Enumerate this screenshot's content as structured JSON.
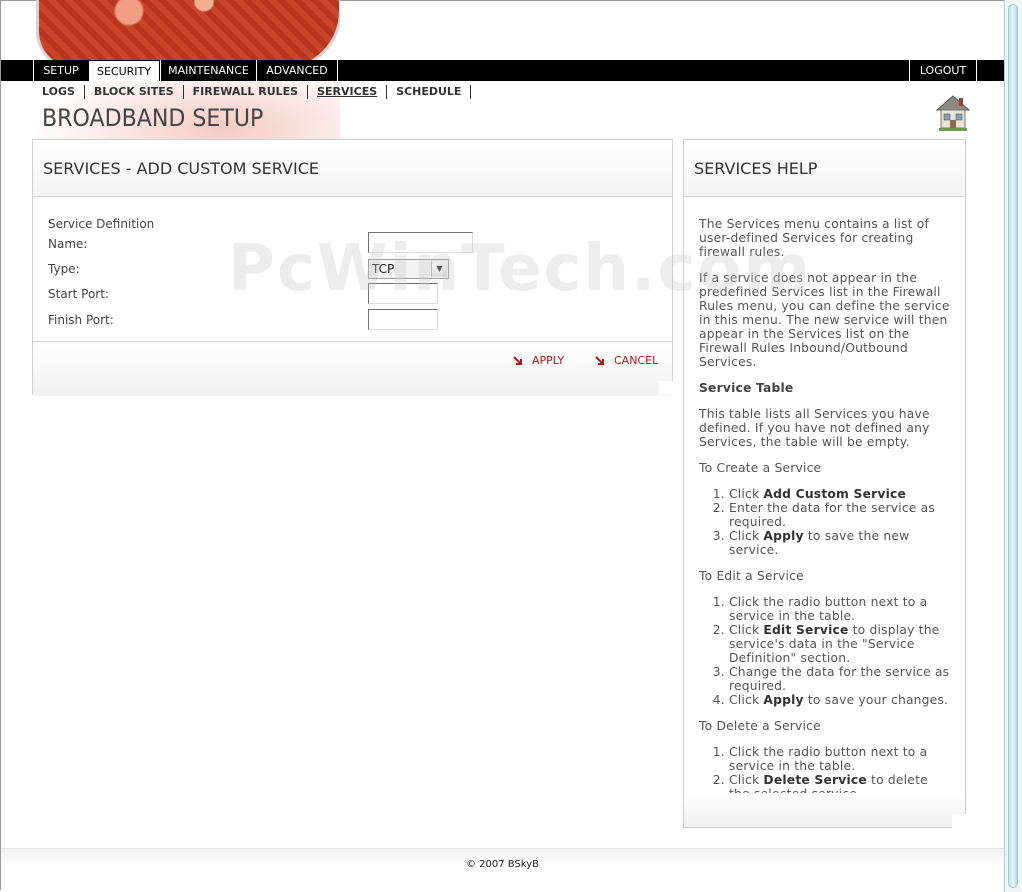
{
  "nav": {
    "tabs": [
      {
        "label": "SETUP"
      },
      {
        "label": "SECURITY"
      },
      {
        "label": "MAINTENANCE"
      },
      {
        "label": "ADVANCED"
      }
    ],
    "logout": "LOGOUT",
    "active_tab": "SECURITY"
  },
  "subnav": {
    "items": [
      {
        "label": "LOGS"
      },
      {
        "label": "BLOCK SITES"
      },
      {
        "label": "FIREWALL RULES"
      },
      {
        "label": "SERVICES"
      },
      {
        "label": "SCHEDULE"
      }
    ],
    "current": "SERVICES"
  },
  "page_title": "BROADBAND SETUP",
  "main_panel": {
    "title": "SERVICES - ADD CUSTOM SERVICE",
    "section_label": "Service Definition",
    "name_label": "Name:",
    "name_value": "",
    "type_label": "Type:",
    "type_value": "TCP",
    "start_port_label": "Start Port:",
    "start_port_value": "",
    "finish_port_label": "Finish Port:",
    "finish_port_value": "",
    "apply_label": "APPLY",
    "cancel_label": "CANCEL"
  },
  "help": {
    "title": "SERVICES HELP",
    "intro": "The Services menu contains a list of user-defined Services for creating firewall rules.",
    "para2": "If a service does not appear in the predefined Services list in the Firewall Rules menu, you can define the service in this menu. The new service will then appear in the Services list on the Firewall Rules Inbound/Outbound Services.",
    "table_heading": "Service Table",
    "table_text": "This table lists all Services you have defined. If you have not defined any Services, the table will be empty.",
    "create_heading": "To Create a Service",
    "create_1_pre": "Click ",
    "create_1_bold": "Add Custom Service",
    "create_2": "Enter the data for the service as required.",
    "create_3_pre": "Click ",
    "create_3_bold": "Apply",
    "create_3_post": " to save the new service.",
    "edit_heading": "To Edit a Service",
    "edit_1": "Click the radio button next to a service in the table.",
    "edit_2_pre": "Click ",
    "edit_2_bold": "Edit Service",
    "edit_2_post": " to display the service's data in the \"Service Definition\" section.",
    "edit_3": "Change the data for the service as required.",
    "edit_4_pre": "Click ",
    "edit_4_bold": "Apply",
    "edit_4_post": " to save your changes.",
    "delete_heading": "To Delete a Service",
    "delete_1": "Click the radio button next to a service in the table.",
    "delete_2_pre": "Click ",
    "delete_2_bold": "Delete Service",
    "delete_2_post": " to delete the selected service."
  },
  "footer": {
    "copyright": "© 2007 BSkyB"
  },
  "watermark": "PcWinTech.com",
  "colors": {
    "nav_bg": "#000000",
    "action_red": "#b01818",
    "panel_border": "#cfcfcf"
  }
}
